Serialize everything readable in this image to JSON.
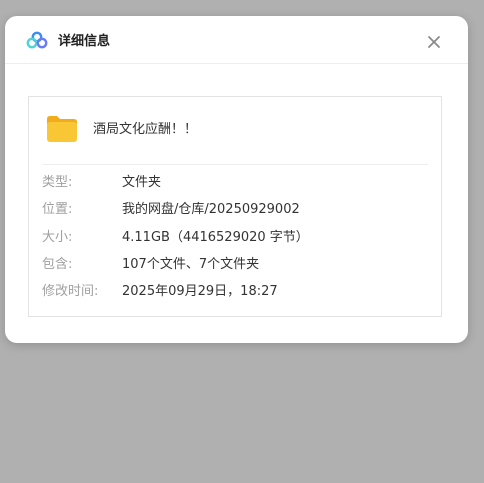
{
  "dialog": {
    "title": "详细信息",
    "logo_icon": "cloud-logo-icon",
    "close_icon": "close-icon"
  },
  "file": {
    "icon": "folder-icon",
    "name": "酒局文化应酬！！"
  },
  "details": [
    {
      "label": "类型:",
      "value": "文件夹"
    },
    {
      "label": "位置:",
      "value": "我的网盘/仓库/20250929002"
    },
    {
      "label": "大小:",
      "value": "4.11GB（4416529020 字节）"
    },
    {
      "label": "包含:",
      "value": "107个文件、7个文件夹"
    },
    {
      "label": "修改时间:",
      "value": "2025年09月29日，18:27"
    }
  ],
  "colors": {
    "backdrop": "#b0b0b0",
    "folder": "#f7c12c",
    "logo_blue": "#3a8ef6",
    "logo_cyan": "#4fd3d9"
  }
}
